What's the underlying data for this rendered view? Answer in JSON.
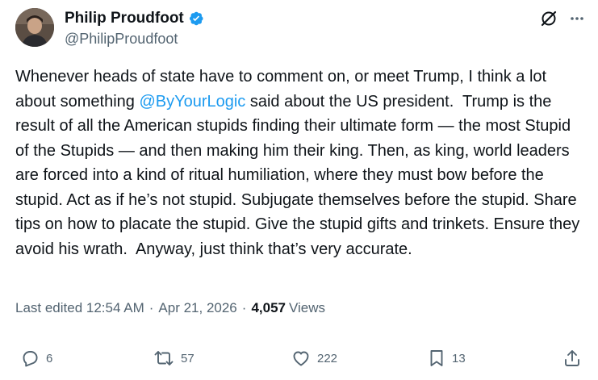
{
  "author": {
    "display_name": "Philip Proudfoot",
    "handle": "@PhilipProudfoot",
    "verified": true
  },
  "post": {
    "text_before_mention": "Whenever heads of state have to comment on, or meet Trump, I think a lot about something ",
    "mention": "@ByYourLogic",
    "text_after_mention": " said about the US president.  Trump is the result of all the American stupids finding their ultimate form — the most Stupid of the Stupids — and then making him their king. Then, as king, world leaders are forced into a kind of ritual humiliation, where they must bow before the stupid. Act as if he’s not stupid. Subjugate themselves before the stupid. Share tips on how to placate the stupid. Give the stupid gifts and trinkets. Ensure they avoid his wrath.  Anyway, just think that’s very accurate."
  },
  "meta": {
    "edited_label": "Last edited 12:54 AM",
    "separator": "·",
    "date": "Apr 21, 2026",
    "views_count": "4,057",
    "views_label": "Views"
  },
  "actions": {
    "reply_count": "6",
    "retweet_count": "57",
    "like_count": "222",
    "bookmark_count": "13"
  },
  "colors": {
    "text": "#0f1419",
    "secondary": "#536471",
    "accent": "#1d9bf0"
  },
  "icons": {
    "verified": "verified-badge-icon",
    "grok": "grok-icon",
    "more": "more-icon",
    "reply": "reply-icon",
    "retweet": "retweet-icon",
    "like": "heart-icon",
    "bookmark": "bookmark-icon",
    "share": "share-icon"
  }
}
